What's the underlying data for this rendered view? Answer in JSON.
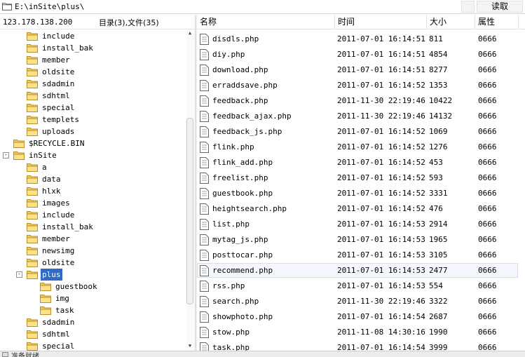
{
  "pathbar": {
    "path": "E:\\inSite\\plus\\",
    "read_label": "读取"
  },
  "infobar": {
    "ip": "123.178.138.200",
    "count": "目录(3),文件(35)"
  },
  "colors": {
    "folder": "#f1cc55",
    "selection": "#316ac5",
    "row_selected": "#f3f7fd"
  },
  "tree": {
    "nodes": [
      {
        "label": "include"
      },
      {
        "label": "install_bak"
      },
      {
        "label": "member"
      },
      {
        "label": "oldsite"
      },
      {
        "label": "sdadmin"
      },
      {
        "label": "sdhtml"
      },
      {
        "label": "special"
      },
      {
        "label": "templets"
      },
      {
        "label": "uploads"
      },
      {
        "label": "$RECYCLE.BIN"
      },
      {
        "label": "inSite",
        "toggle": "-"
      },
      {
        "label": "a"
      },
      {
        "label": "data"
      },
      {
        "label": "hlxk"
      },
      {
        "label": "images"
      },
      {
        "label": "include"
      },
      {
        "label": "install_bak"
      },
      {
        "label": "member"
      },
      {
        "label": "newsimg"
      },
      {
        "label": "oldsite"
      },
      {
        "label": "plus",
        "toggle": "-",
        "selected": true
      },
      {
        "label": "guestbook"
      },
      {
        "label": "img"
      },
      {
        "label": "task"
      },
      {
        "label": "sdadmin"
      },
      {
        "label": "sdhtml"
      },
      {
        "label": "special"
      }
    ]
  },
  "list": {
    "headers": {
      "name": "名称",
      "time": "时间",
      "size": "大小",
      "attr": "属性"
    },
    "rows": [
      {
        "name": "disdls.php",
        "time": "2011-07-01 16:14:51",
        "size": "811",
        "attr": "0666"
      },
      {
        "name": "diy.php",
        "time": "2011-07-01 16:14:51",
        "size": "4854",
        "attr": "0666"
      },
      {
        "name": "download.php",
        "time": "2011-07-01 16:14:51",
        "size": "8277",
        "attr": "0666"
      },
      {
        "name": "erraddsave.php",
        "time": "2011-07-01 16:14:52",
        "size": "1353",
        "attr": "0666"
      },
      {
        "name": "feedback.php",
        "time": "2011-11-30 22:19:46",
        "size": "10422",
        "attr": "0666"
      },
      {
        "name": "feedback_ajax.php",
        "time": "2011-11-30 22:19:46",
        "size": "14132",
        "attr": "0666"
      },
      {
        "name": "feedback_js.php",
        "time": "2011-07-01 16:14:52",
        "size": "1069",
        "attr": "0666"
      },
      {
        "name": "flink.php",
        "time": "2011-07-01 16:14:52",
        "size": "1276",
        "attr": "0666"
      },
      {
        "name": "flink_add.php",
        "time": "2011-07-01 16:14:52",
        "size": "453",
        "attr": "0666"
      },
      {
        "name": "freelist.php",
        "time": "2011-07-01 16:14:52",
        "size": "593",
        "attr": "0666"
      },
      {
        "name": "guestbook.php",
        "time": "2011-07-01 16:14:52",
        "size": "3331",
        "attr": "0666"
      },
      {
        "name": "heightsearch.php",
        "time": "2011-07-01 16:14:52",
        "size": "476",
        "attr": "0666"
      },
      {
        "name": "list.php",
        "time": "2011-07-01 16:14:53",
        "size": "2914",
        "attr": "0666"
      },
      {
        "name": "mytag_js.php",
        "time": "2011-07-01 16:14:53",
        "size": "1965",
        "attr": "0666"
      },
      {
        "name": "posttocar.php",
        "time": "2011-07-01 16:14:53",
        "size": "3105",
        "attr": "0666"
      },
      {
        "name": "recommend.php",
        "time": "2011-07-01 16:14:53",
        "size": "2477",
        "attr": "0666",
        "selected": true
      },
      {
        "name": "rss.php",
        "time": "2011-07-01 16:14:53",
        "size": "554",
        "attr": "0666"
      },
      {
        "name": "search.php",
        "time": "2011-11-30 22:19:46",
        "size": "3322",
        "attr": "0666"
      },
      {
        "name": "showphoto.php",
        "time": "2011-07-01 16:14:54",
        "size": "2687",
        "attr": "0666"
      },
      {
        "name": "stow.php",
        "time": "2011-11-08 14:30:16",
        "size": "1990",
        "attr": "0666"
      },
      {
        "name": "task.php",
        "time": "2011-07-01 16:14:54",
        "size": "3999",
        "attr": "0666"
      }
    ]
  },
  "status": {
    "text": "准备就绪"
  }
}
